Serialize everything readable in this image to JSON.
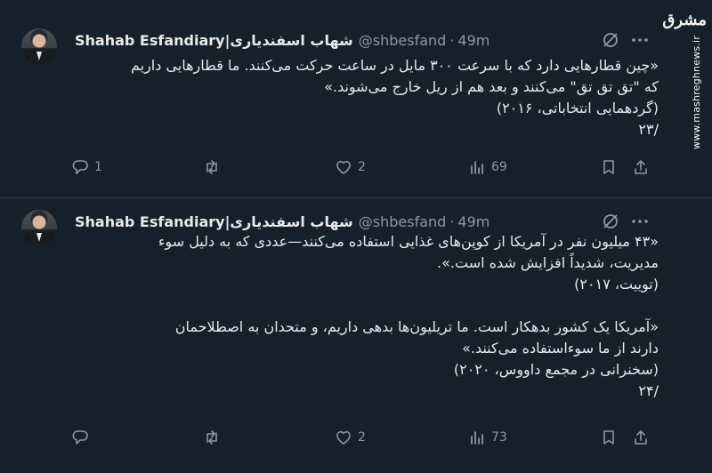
{
  "watermark": {
    "logo_text": "مشرق",
    "url": "www.mashreghnews.ir"
  },
  "tweets": [
    {
      "display_name": "شهاب اسفندیاری|Shahab Esfandiary",
      "handle": "@shbesfand",
      "separator": "·",
      "time": "49m",
      "text_lines": "«چین قطارهایی دارد که با سرعت ۳۰۰ مایل در ساعت حرکت می‌کنند. ما قطارهایی داریم\nکه \"تق تق تق\" می‌کنند و بعد هم از ریل خارج می‌شوند.»\n(گردهمایی انتخاباتی، ۲۰۱۶)\n/۲۳",
      "replies": "1",
      "retweets": "",
      "likes": "2",
      "views": "69"
    },
    {
      "display_name": "شهاب اسفندیاری|Shahab Esfandiary",
      "handle": "@shbesfand",
      "separator": "·",
      "time": "49m",
      "text_para1": "«۴۳ میلیون نفر در آمریکا از کوپن‌های غذایی استفاده می‌کنند—عددی که به دلیل سوء\nمدیریت، شدیداً افزایش شده است.».\n(توییت، ۲۰۱۷)",
      "text_para2": "«آمریکا یک کشور بدهکار است. ما تریلیون‌ها بدهی داریم، و متحدان به اصطلاحمان\nدارند از ما سوءاستفاده می‌کنند.»\n(سخنرانی در مجمع داووس، ۲۰۲۰)\n/۲۴",
      "replies": "",
      "retweets": "",
      "likes": "2",
      "views": "73"
    }
  ],
  "icons": {
    "reply": "reply-icon",
    "retweet": "retweet-icon",
    "like": "heart-icon",
    "views": "views-chart-icon",
    "bookmark": "bookmark-icon",
    "share": "share-icon",
    "grok": "grok-icon",
    "more": "more-dots-icon"
  },
  "colors": {
    "background": "#15202b",
    "text": "#e7e9ea",
    "muted": "#8b98a5"
  }
}
